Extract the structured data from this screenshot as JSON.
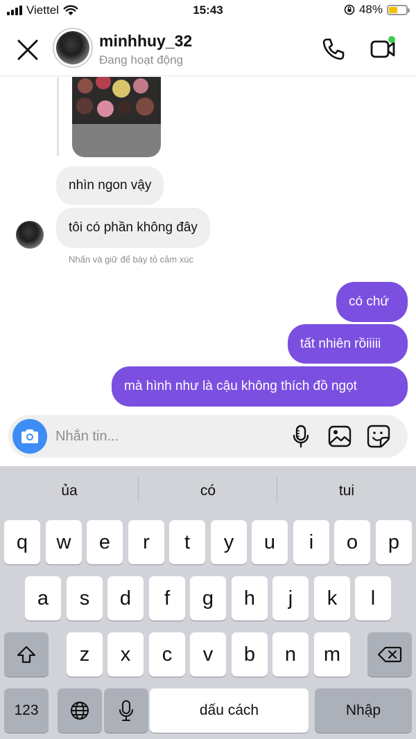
{
  "status_bar": {
    "carrier": "Viettel",
    "time": "15:43",
    "battery_percent": "48%",
    "battery_level": 0.48
  },
  "header": {
    "contact_name": "minhhuy_32",
    "contact_status": "Đang hoạt động",
    "online": true
  },
  "messages": [
    {
      "direction": "incoming",
      "text": "nhìn ngon vậy"
    },
    {
      "direction": "incoming",
      "text": "tôi có phần không đây"
    },
    {
      "direction": "outgoing",
      "text": "có chứ"
    },
    {
      "direction": "outgoing",
      "text": "tất nhiên rồiiiii"
    },
    {
      "direction": "outgoing",
      "text": "mà hình như là cậu không thích đồ ngọt"
    }
  ],
  "reaction_hint": "Nhấn và giữ để bày tỏ cảm xúc",
  "composer": {
    "placeholder": "Nhắn tin..."
  },
  "keyboard": {
    "suggestions": [
      "ủa",
      "có",
      "tui"
    ],
    "row1": [
      "q",
      "w",
      "e",
      "r",
      "t",
      "y",
      "u",
      "i",
      "o",
      "p"
    ],
    "row2": [
      "a",
      "s",
      "d",
      "f",
      "g",
      "h",
      "j",
      "k",
      "l"
    ],
    "row3": [
      "z",
      "x",
      "c",
      "v",
      "b",
      "n",
      "m"
    ],
    "numbers_key": "123",
    "space_key": "dấu cách",
    "return_key": "Nhập"
  },
  "colors": {
    "outgoing_bubble": "#7b4fe0",
    "incoming_bubble": "#efefef",
    "camera_button": "#3e8cf5",
    "online_dot": "#3ccf4e"
  }
}
